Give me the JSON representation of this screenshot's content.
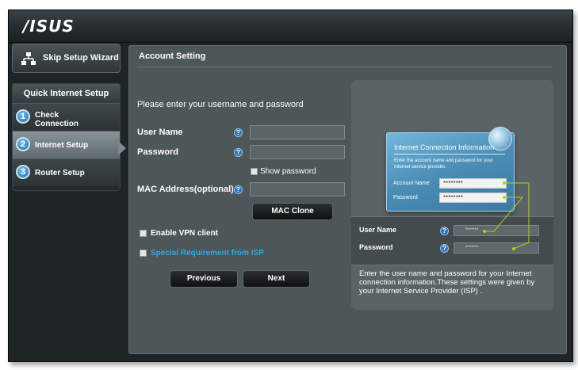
{
  "brand": {
    "logo_text": "/ISUS"
  },
  "sidebar": {
    "skip_label": "Skip Setup Wizard",
    "section_title": "Quick Internet Setup",
    "steps": [
      {
        "number": "1",
        "line1": "Check",
        "line2": "Connection"
      },
      {
        "number": "2",
        "line1": "Internet Setup",
        "line2": ""
      },
      {
        "number": "3",
        "line1": "Router Setup",
        "line2": ""
      }
    ],
    "active_step": 2
  },
  "main": {
    "title": "Account Setting",
    "prompt": "Please enter your username and password",
    "username_label": "User Name",
    "password_label": "Password",
    "username_value": "",
    "password_value": "",
    "show_password_label": "Show password",
    "mac_label": "MAC Address(optional)",
    "mac_value": "",
    "mac_clone_label": "MAC Clone",
    "vpn_label": "Enable VPN client",
    "isp_label": "Special Requirement from ISP",
    "previous_label": "Previous",
    "next_label": "Next",
    "help_glyph": "?"
  },
  "illustration": {
    "card_title": "Internet Connection Information",
    "card_desc": "Enter the account name and password for your Internet service provider.",
    "account_label": "Account Name",
    "account_value": "********",
    "password_label": "Password",
    "password_value": "********",
    "strip_username_label": "User Name",
    "strip_password_label": "Password",
    "strip_username_value": "*******",
    "strip_password_value": "*******",
    "note": "Enter the user name and password for your Internet connection information.These settings were given by your Internet Service Provider (ISP) .",
    "connector_color": "#a6d61a"
  },
  "colors": {
    "help_blue": "#2e73b8",
    "isp_link": "#35a6e4",
    "panel_bg": "#4d5659"
  }
}
